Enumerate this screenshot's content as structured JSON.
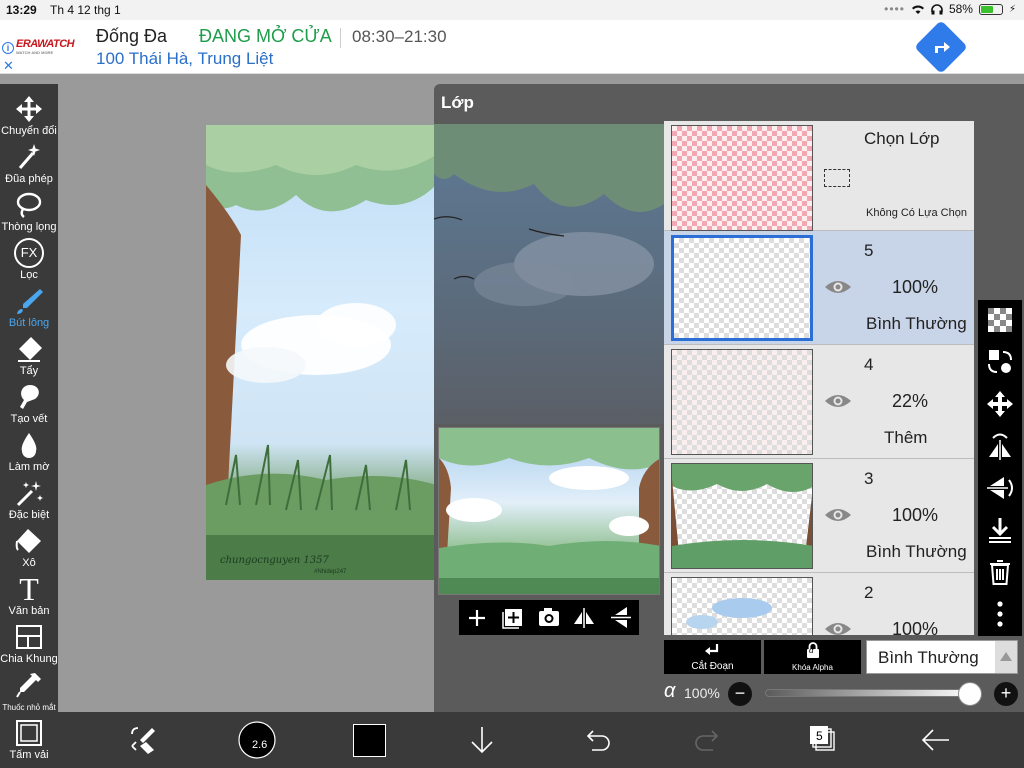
{
  "status_bar": {
    "time": "13:29",
    "date": "Th 4 12 thg 1",
    "battery": "58%",
    "battery_level": 0.58
  },
  "ad": {
    "brand": "ERAWATCH",
    "brand_tagline": "WATCH AND MORE",
    "name": "Đống Đa",
    "status": "ĐANG MỞ CỬA",
    "hours": "08:30–21:30",
    "address": "100 Thái Hà, Trung Liệt",
    "info_glyph": "i",
    "close_glyph": "✕",
    "colors": {
      "status": "#1e9e4a",
      "address": "#2a6fc9",
      "direction": "#2f7bea"
    }
  },
  "tools": [
    {
      "label": "Chuyển đổi",
      "icon": "move-icon"
    },
    {
      "label": "Đũa phép",
      "icon": "magic-wand-icon"
    },
    {
      "label": "Thòng lọng",
      "icon": "lasso-icon"
    },
    {
      "label": "Lọc",
      "icon": "fx-filter-icon",
      "glyph": "FX"
    },
    {
      "label": "Bút lông",
      "icon": "brush-icon",
      "active": true
    },
    {
      "label": "Tẩy",
      "icon": "eraser-icon"
    },
    {
      "label": "Tạo vết",
      "icon": "smudge-icon"
    },
    {
      "label": "Làm mờ",
      "icon": "blur-drop-icon"
    },
    {
      "label": "Đặc biệt",
      "icon": "special-icon"
    },
    {
      "label": "Xô",
      "icon": "bucket-icon"
    },
    {
      "label": "Văn bản",
      "icon": "text-icon",
      "glyph": "T"
    },
    {
      "label": "Chia Khung",
      "icon": "frame-divide-icon"
    },
    {
      "label": "Thuốc nhỏ mắt",
      "icon": "eyedropper-icon"
    },
    {
      "label": "Tấm vải",
      "icon": "canvas-icon"
    }
  ],
  "artwork": {
    "signature": "chungocnguyen 1357",
    "subsig": "#Nhidep247"
  },
  "layer_panel": {
    "title": "Lớp",
    "selection": {
      "title": "Chọn Lớp",
      "none": "Không Có Lựa Chọn"
    },
    "layers": [
      {
        "number": "5",
        "opacity": "100%",
        "mode": "Bình Thường",
        "selected": true
      },
      {
        "number": "4",
        "opacity": "22%",
        "mode": "Thêm"
      },
      {
        "number": "3",
        "opacity": "100%",
        "mode": "Bình Thường"
      },
      {
        "number": "2",
        "opacity": "100%",
        "mode": ""
      }
    ],
    "clip_label": "Cắt Đoạn",
    "alpha_lock_label": "Khóa Alpha",
    "alpha_glyph": "α",
    "blend_mode": "Bình Thường",
    "opacity_symbol": "α",
    "opacity_value": "100%",
    "opacity_level": 1.0,
    "minus": "−",
    "plus": "+"
  },
  "bottom_bar": {
    "layer_count": "5",
    "brush_size": "2.6"
  },
  "colors": {
    "accent": "#4aa6ee",
    "selected_layer": "#2b6fd6",
    "toolbar": "#3a3a3a"
  }
}
